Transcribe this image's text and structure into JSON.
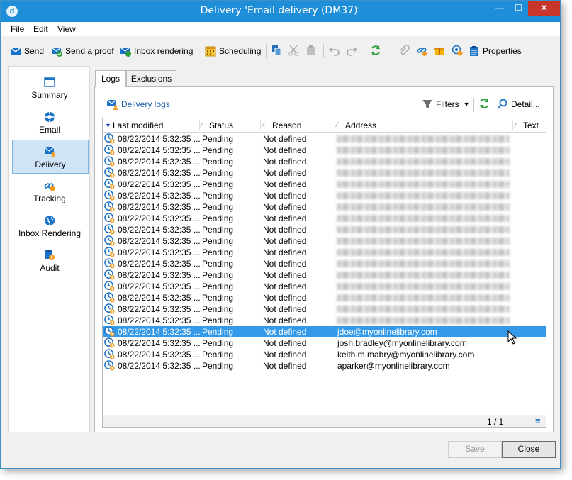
{
  "window": {
    "title": "Delivery 'Email delivery (DM37)'",
    "min_glyph": "—",
    "max_glyph": "☐",
    "close_glyph": "✕",
    "app_icon_glyph": "d"
  },
  "menu": [
    "File",
    "Edit",
    "View"
  ],
  "toolbar": {
    "send": "Send",
    "send_proof": "Send a proof",
    "inbox_rendering": "Inbox rendering",
    "scheduling": "Scheduling",
    "properties": "Properties"
  },
  "sidebar": [
    {
      "label": "Summary",
      "icon": "summary-icon"
    },
    {
      "label": "Email",
      "icon": "email-icon"
    },
    {
      "label": "Delivery",
      "icon": "delivery-icon",
      "selected": true
    },
    {
      "label": "Tracking",
      "icon": "tracking-icon"
    },
    {
      "label": "Inbox Rendering",
      "icon": "globe-icon"
    },
    {
      "label": "Audit",
      "icon": "audit-icon"
    }
  ],
  "tabs": {
    "logs": "Logs",
    "exclusions": "Exclusions"
  },
  "subtoolbar": {
    "delivery_logs": "Delivery logs",
    "filters": "Filters",
    "detail": "Detail..."
  },
  "columns": {
    "last_modified": "Last modified",
    "status": "Status",
    "reason": "Reason",
    "address": "Address",
    "text": "Text"
  },
  "rows": [
    {
      "date": "08/22/2014 5:32:35 ...",
      "status": "Pending",
      "reason": "Not defined",
      "address": ""
    },
    {
      "date": "08/22/2014 5:32:35 ...",
      "status": "Pending",
      "reason": "Not defined",
      "address": ""
    },
    {
      "date": "08/22/2014 5:32:35 ...",
      "status": "Pending",
      "reason": "Not defined",
      "address": ""
    },
    {
      "date": "08/22/2014 5:32:35 ...",
      "status": "Pending",
      "reason": "Not defined",
      "address": ""
    },
    {
      "date": "08/22/2014 5:32:35 ...",
      "status": "Pending",
      "reason": "Not defined",
      "address": ""
    },
    {
      "date": "08/22/2014 5:32:35 ...",
      "status": "Pending",
      "reason": "Not defined",
      "address": ""
    },
    {
      "date": "08/22/2014 5:32:35 ...",
      "status": "Pending",
      "reason": "Not defined",
      "address": ""
    },
    {
      "date": "08/22/2014 5:32:35 ...",
      "status": "Pending",
      "reason": "Not defined",
      "address": ""
    },
    {
      "date": "08/22/2014 5:32:35 ...",
      "status": "Pending",
      "reason": "Not defined",
      "address": ""
    },
    {
      "date": "08/22/2014 5:32:35 ...",
      "status": "Pending",
      "reason": "Not defined",
      "address": ""
    },
    {
      "date": "08/22/2014 5:32:35 ...",
      "status": "Pending",
      "reason": "Not defined",
      "address": ""
    },
    {
      "date": "08/22/2014 5:32:35 ...",
      "status": "Pending",
      "reason": "Not defined",
      "address": ""
    },
    {
      "date": "08/22/2014 5:32:35 ...",
      "status": "Pending",
      "reason": "Not defined",
      "address": ""
    },
    {
      "date": "08/22/2014 5:32:35 ...",
      "status": "Pending",
      "reason": "Not defined",
      "address": ""
    },
    {
      "date": "08/22/2014 5:32:35 ...",
      "status": "Pending",
      "reason": "Not defined",
      "address": ""
    },
    {
      "date": "08/22/2014 5:32:35 ...",
      "status": "Pending",
      "reason": "Not defined",
      "address": ""
    },
    {
      "date": "08/22/2014 5:32:35 ...",
      "status": "Pending",
      "reason": "Not defined",
      "address": ""
    },
    {
      "date": "08/22/2014 5:32:35 ...",
      "status": "Pending",
      "reason": "Not defined",
      "address": "jdoe@myonlinelibrary.com",
      "selected": true
    },
    {
      "date": "08/22/2014 5:32:35 ...",
      "status": "Pending",
      "reason": "Not defined",
      "address": "josh.bradley@myonlinelibrary.com"
    },
    {
      "date": "08/22/2014 5:32:35 ...",
      "status": "Pending",
      "reason": "Not defined",
      "address": "keith.m.mabry@myonlinelibrary.com"
    },
    {
      "date": "08/22/2014 5:32:35 ...",
      "status": "Pending",
      "reason": "Not defined",
      "address": "aparker@myonlinelibrary.com"
    }
  ],
  "pagination": "1 / 1",
  "buttons": {
    "save": "Save",
    "close": "Close"
  },
  "colors": {
    "titlebar": "#1f8ed8",
    "selection": "#3399e8",
    "nav_selected": "#cfe4f7",
    "accent_green": "#2e9e3a"
  }
}
